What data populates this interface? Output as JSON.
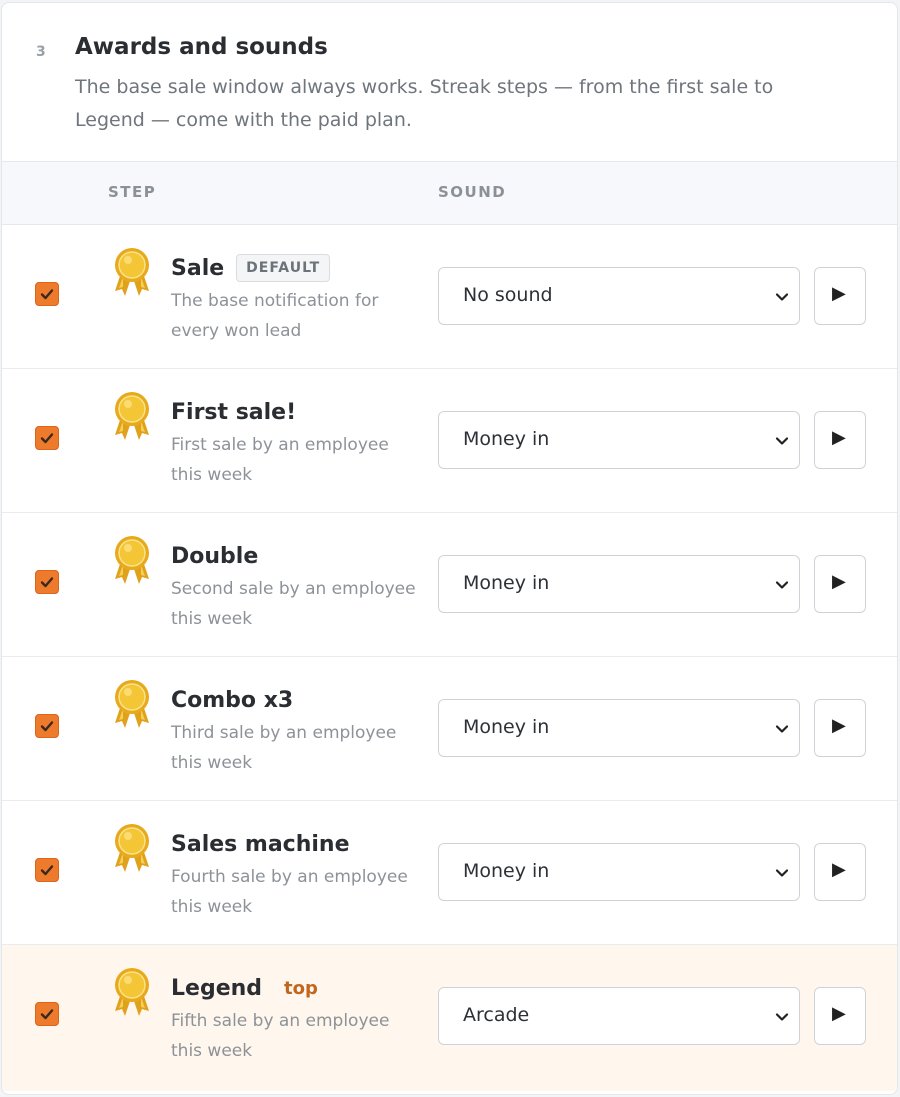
{
  "section": {
    "number": "3",
    "title": "Awards and sounds",
    "description": "The base sale window always works. Streak steps — from the first sale to Legend — come with the paid plan."
  },
  "table": {
    "col_step": "STEP",
    "col_sound": "SOUND"
  },
  "icons": {
    "medal": "medal-icon",
    "checkbox": "checkmark-icon",
    "dropdown": "chevron-down-icon",
    "play": "play-icon"
  },
  "colors": {
    "accent": "#ee7a2b",
    "highlight_row": "#fff7ee",
    "top_badge": "#c2661d"
  },
  "rows": [
    {
      "name": "Sale",
      "badge": "DEFAULT",
      "desc": "The base notification for every won lead",
      "sound": "No sound",
      "checked": true
    },
    {
      "name": "First sale!",
      "desc": "First sale by an employee this week",
      "sound": "Money in",
      "checked": true
    },
    {
      "name": "Double",
      "desc": "Second sale by an employee this week",
      "sound": "Money in",
      "checked": true
    },
    {
      "name": "Combo x3",
      "desc": "Third sale by an employee this week",
      "sound": "Money in",
      "checked": true
    },
    {
      "name": "Sales machine",
      "desc": "Fourth sale by an employee this week",
      "sound": "Money in",
      "checked": true
    },
    {
      "name": "Legend",
      "tag": "top",
      "desc": "Fifth sale by an employee this week",
      "sound": "Arcade",
      "checked": true
    }
  ]
}
